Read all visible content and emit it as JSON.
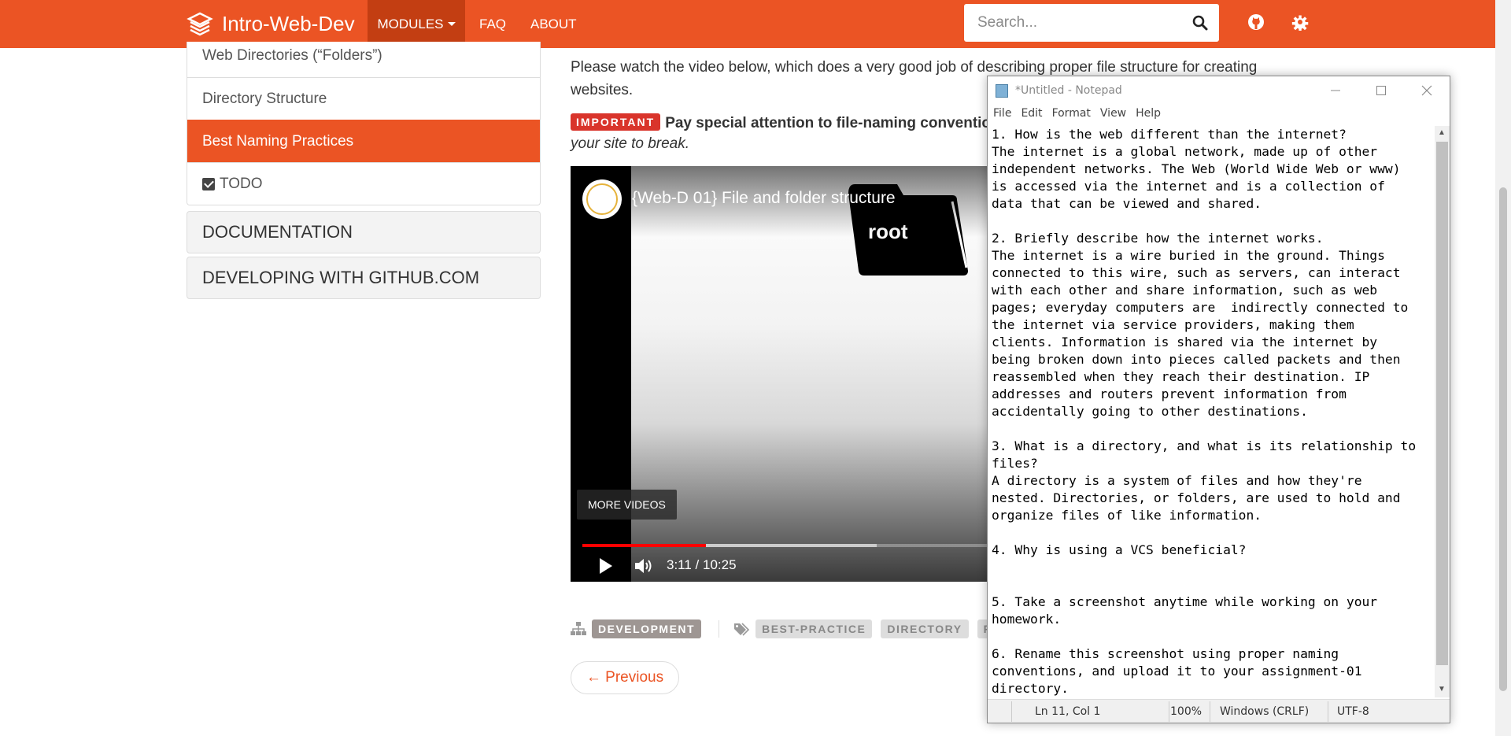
{
  "navbar": {
    "brand": "Intro-Web-Dev",
    "modules_label": "MODULES",
    "faq_label": "FAQ",
    "about_label": "ABOUT",
    "search_placeholder": "Search...",
    "accent_color": "#eb5424"
  },
  "sidebar": {
    "items": [
      {
        "label": "Web Directories (“Folders”)"
      },
      {
        "label": "Directory Structure"
      },
      {
        "label": "Best Naming Practices",
        "active": true
      },
      {
        "label": "TODO"
      }
    ],
    "panels": [
      "DOCUMENTATION",
      "DEVELOPING WITH GITHUB.COM"
    ]
  },
  "main": {
    "intro": "Please watch the video below, which does a very good job of describing proper file structure for creating websites.",
    "important_label": "IMPORTANT",
    "important_text": "Pay special attention to file-naming conventio",
    "important_cont": "your site to break.",
    "video": {
      "title": "{Web-D 01} File and folder structure",
      "folder_label": "root",
      "more_videos": "MORE VIDEOS",
      "time": "3:11 / 10:25",
      "played_fraction": 0.305,
      "buffered_fraction": 0.727
    },
    "category": "DEVELOPMENT",
    "tags": [
      "BEST-PRACTICE",
      "DIRECTORY",
      "FIL"
    ],
    "prev_label": "← Previous"
  },
  "notepad": {
    "title": "*Untitled - Notepad",
    "menu": [
      "File",
      "Edit",
      "Format",
      "View",
      "Help"
    ],
    "content": "1. How is the web different than the internet?\nThe internet is a global network, made up of other\nindependent networks. The Web (World Wide Web or www)\nis accessed via the internet and is a collection of\ndata that can be viewed and shared.\n\n2. Briefly describe how the internet works.\nThe internet is a wire buried in the ground. Things\nconnected to this wire, such as servers, can interact\nwith each other and share information, such as web\npages; everyday computers are  indirectly connected to\nthe internet via service providers, making them\nclients. Information is shared via the internet by\nbeing broken down into pieces called packets and then\nreassembled when they reach their destination. IP\naddresses and routers prevent information from\naccidentally going to other destinations.\n\n3. What is a directory, and what is its relationship to\nfiles?\nA directory is a system of files and how they're\nnested. Directories, or folders, are used to hold and\norganize files of like information.\n\n4. Why is using a VCS beneficial?\n\n\n5. Take a screenshot anytime while working on your\nhomework.\n\n6. Rename this screenshot using proper naming\nconventions, and upload it to your assignment-01\ndirectory.",
    "status": {
      "position": "Ln 11, Col 1",
      "zoom": "100%",
      "line_endings": "Windows (CRLF)",
      "encoding": "UTF-8"
    }
  }
}
